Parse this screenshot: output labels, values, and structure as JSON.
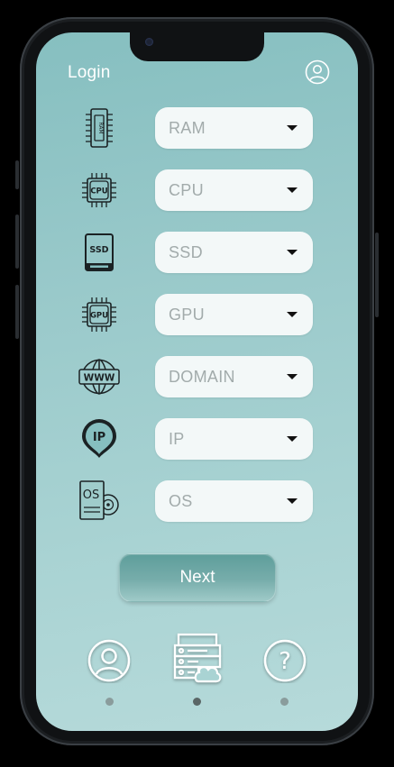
{
  "header": {
    "title": "Login",
    "profile_icon": "user-circle-icon"
  },
  "fields": [
    {
      "icon": "ram-chip-icon",
      "icon_text": "RAM",
      "placeholder": "RAM"
    },
    {
      "icon": "cpu-chip-icon",
      "icon_text": "CPU",
      "placeholder": "CPU"
    },
    {
      "icon": "ssd-drive-icon",
      "icon_text": "SSD",
      "placeholder": "SSD"
    },
    {
      "icon": "gpu-chip-icon",
      "icon_text": "GPU",
      "placeholder": "GPU"
    },
    {
      "icon": "www-globe-icon",
      "icon_text": "WWW",
      "placeholder": "DOMAIN"
    },
    {
      "icon": "ip-pin-icon",
      "icon_text": "IP",
      "placeholder": "IP"
    },
    {
      "icon": "os-disc-icon",
      "icon_text": "OS",
      "placeholder": "OS"
    }
  ],
  "next_button": {
    "label": "Next"
  },
  "bottom_nav": [
    {
      "icon": "user-icon"
    },
    {
      "icon": "server-cloud-icon"
    },
    {
      "icon": "help-icon",
      "text": "?"
    }
  ],
  "colors": {
    "screen_bg": "#99c9ca",
    "button": "#6fa9a6",
    "select_bg": "#f3f8f8"
  }
}
